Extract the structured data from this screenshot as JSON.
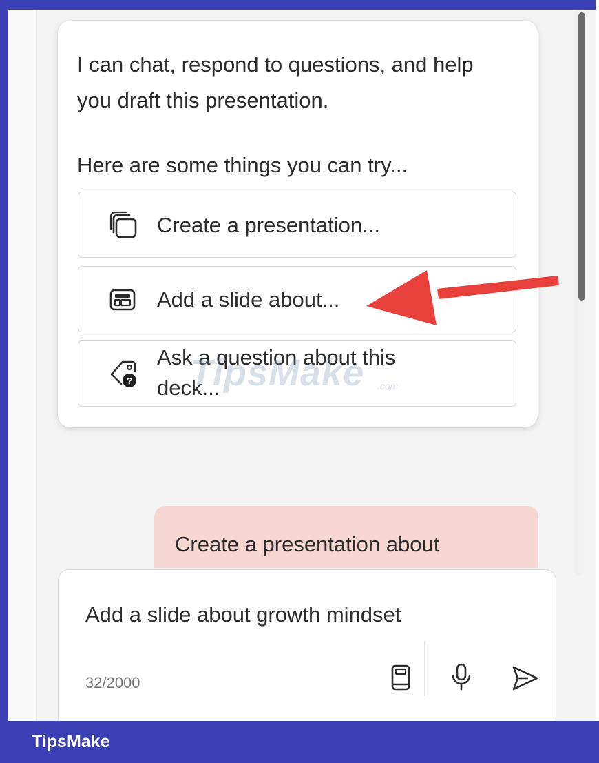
{
  "chat": {
    "intro_line1": "I can chat, respond to questions, and help",
    "intro_line2": "you draft this presentation.",
    "try_text": "Here are some things you can try...",
    "suggestions": [
      {
        "label": "Create a presentation...",
        "icon": "stacked-slides-icon"
      },
      {
        "label": "Add a slide about...",
        "icon": "slide-layout-icon"
      },
      {
        "label_line1": "Ask a question about this",
        "label_line2": "deck...",
        "icon": "tag-question-icon"
      }
    ],
    "user_message": "Create a presentation about"
  },
  "compose": {
    "value": "Add a slide about growth mindset",
    "char_count": "32/2000",
    "buttons": [
      "notebook-icon",
      "microphone-icon",
      "send-icon"
    ]
  },
  "watermark": {
    "text": "TipsMake",
    "suffix": ".com"
  },
  "footer": {
    "brand": "TipsMake"
  },
  "colors": {
    "frame_border": "#3a3fb6",
    "user_bubble": "#f5d6d0",
    "annotation_arrow": "#e8403a"
  }
}
